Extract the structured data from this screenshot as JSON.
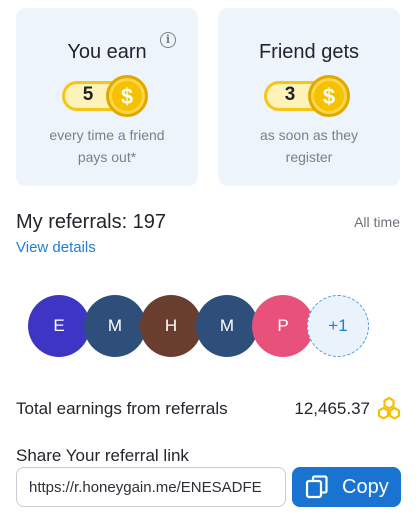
{
  "cards": [
    {
      "title": "You earn",
      "amount": "5",
      "currency_symbol": "$",
      "description_line1": "every time a friend",
      "description_line2": "pays out*",
      "icon": "info-icon"
    },
    {
      "title": "Friend gets",
      "amount": "3",
      "currency_symbol": "$",
      "description_line1": "as soon as they",
      "description_line2": "register"
    }
  ],
  "referrals": {
    "title": "My referrals: 197",
    "period": "All time",
    "view_details": "View details",
    "avatars": [
      {
        "initial": "E",
        "color": "#3f35c4"
      },
      {
        "initial": "M",
        "color": "#2e4f7a"
      },
      {
        "initial": "H",
        "color": "#6a3e2e"
      },
      {
        "initial": "M",
        "color": "#2e4f7a"
      },
      {
        "initial": "P",
        "color": "#e8527a"
      }
    ],
    "more": "+1"
  },
  "earnings": {
    "label": "Total earnings from referrals",
    "value": "12,465.37",
    "icon": "honeycomb-icon"
  },
  "share": {
    "label": "Share Your referral link",
    "link": "https://r.honeygain.me/ENESADFE",
    "copy_label": "Copy"
  }
}
